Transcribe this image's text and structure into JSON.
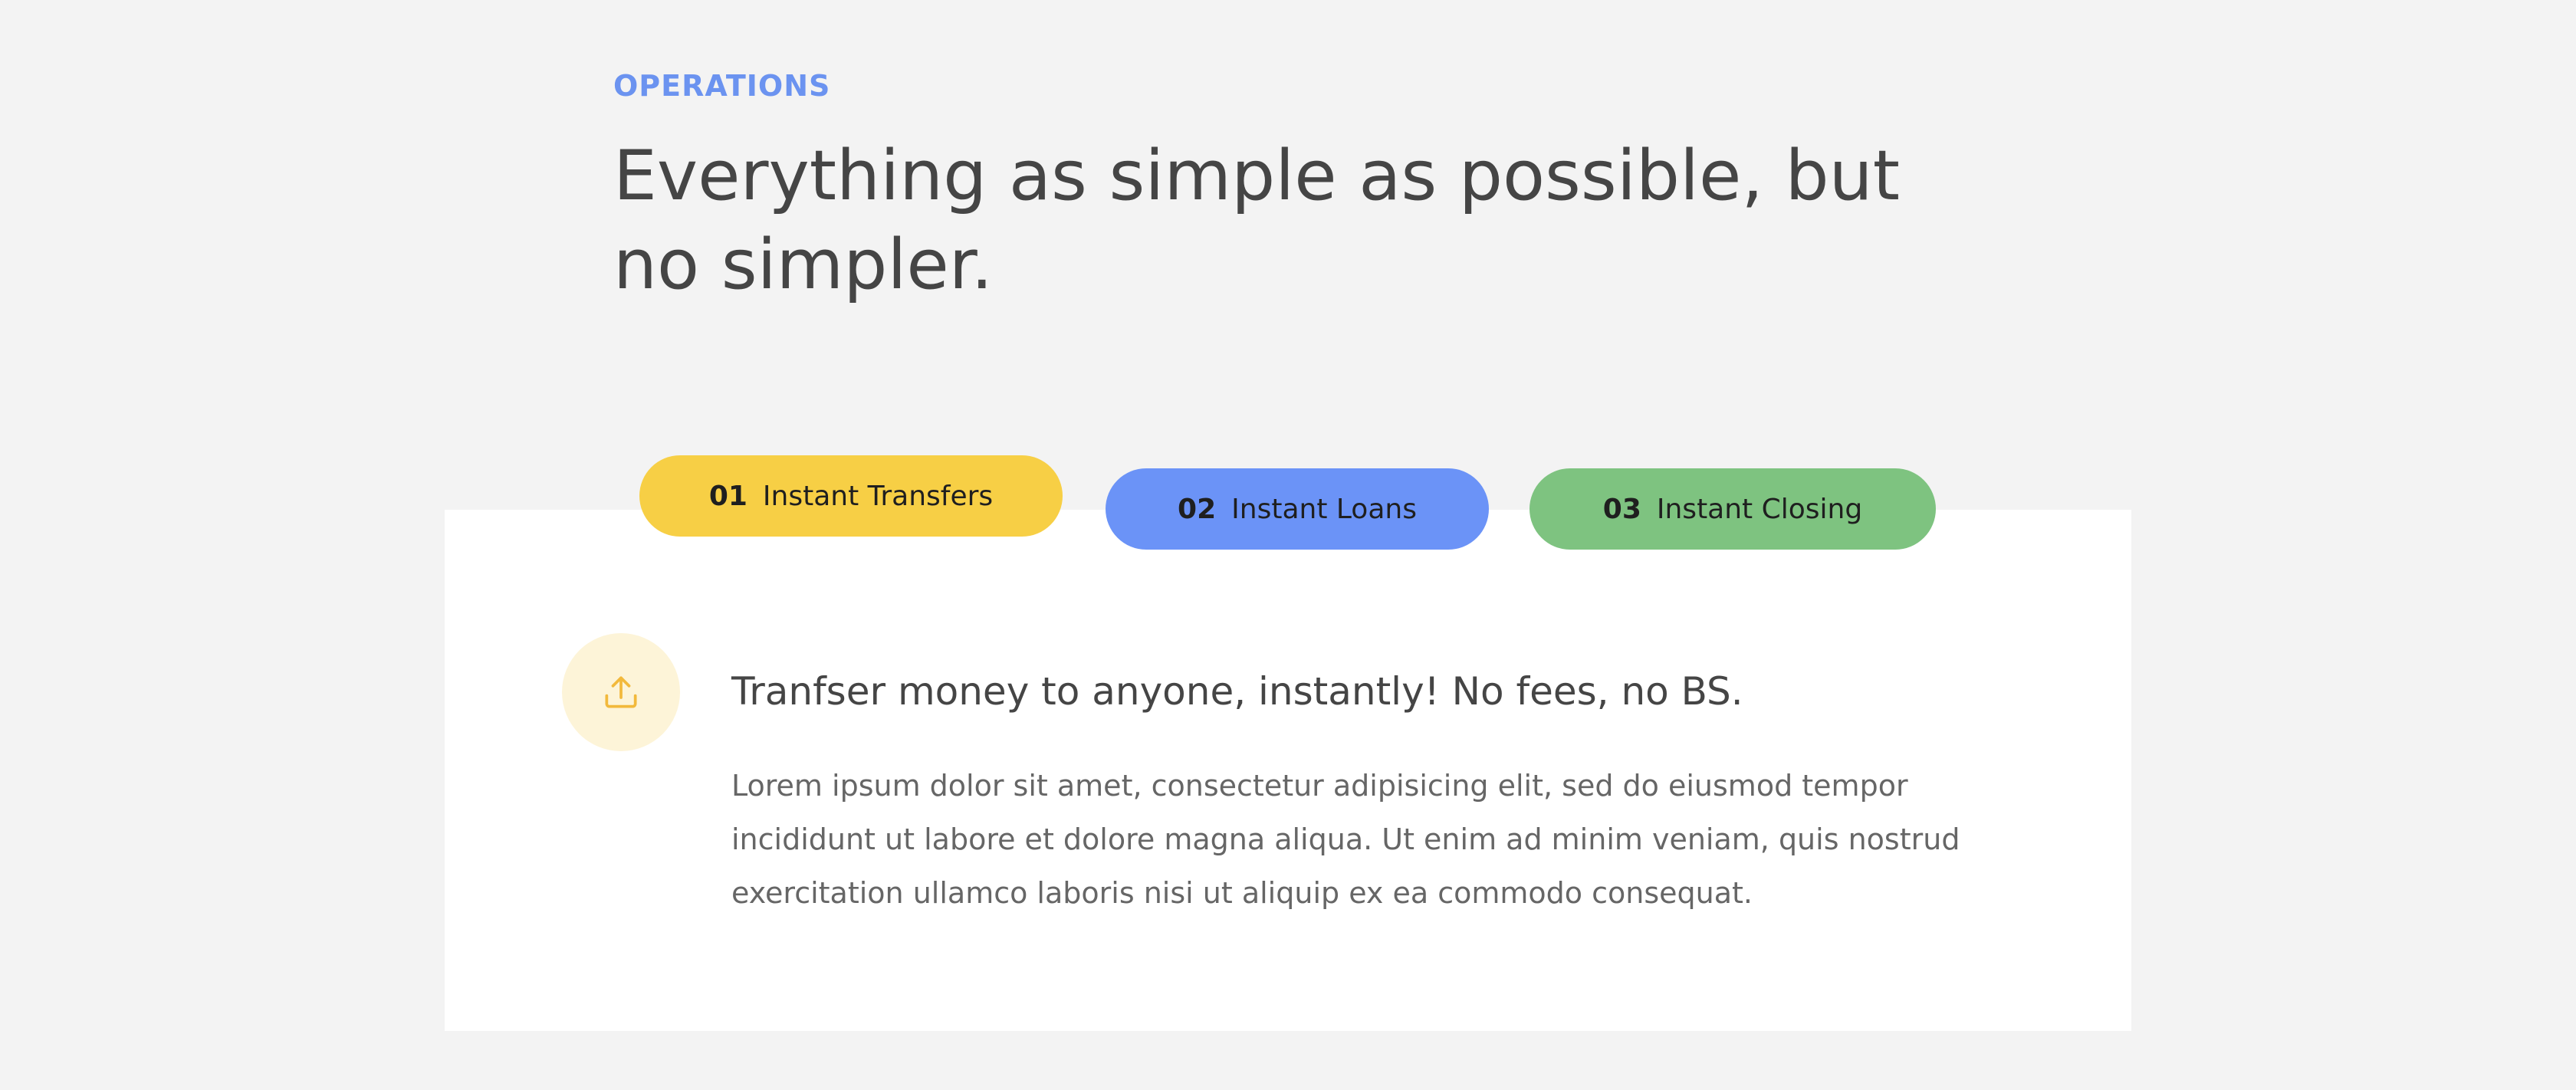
{
  "section": {
    "eyebrow": "OPERATIONS",
    "heading": "Everything as simple as possible, but no simpler."
  },
  "tabs": [
    {
      "number": "01",
      "label": "Instant Transfers",
      "color": "#f7cf45"
    },
    {
      "number": "02",
      "label": "Instant Loans",
      "color": "#6b93f7"
    },
    {
      "number": "03",
      "label": "Instant Closing",
      "color": "#7ec380"
    }
  ],
  "feature": {
    "icon": "upload-icon",
    "title": "Tranfser money to anyone, instantly! No fees, no BS.",
    "body": "Lorem ipsum dolor sit amet, consectetur adipisicing elit, sed do eiusmod tempor incididunt ut labore et dolore magna aliqua. Ut enim ad minim veniam, quis nostrud exercitation ullamco laboris nisi ut aliquip ex ea commodo consequat."
  },
  "colors": {
    "accent": "#6b93f0",
    "icon_bg": "#fdf4d8",
    "icon_stroke": "#f2b93c"
  }
}
